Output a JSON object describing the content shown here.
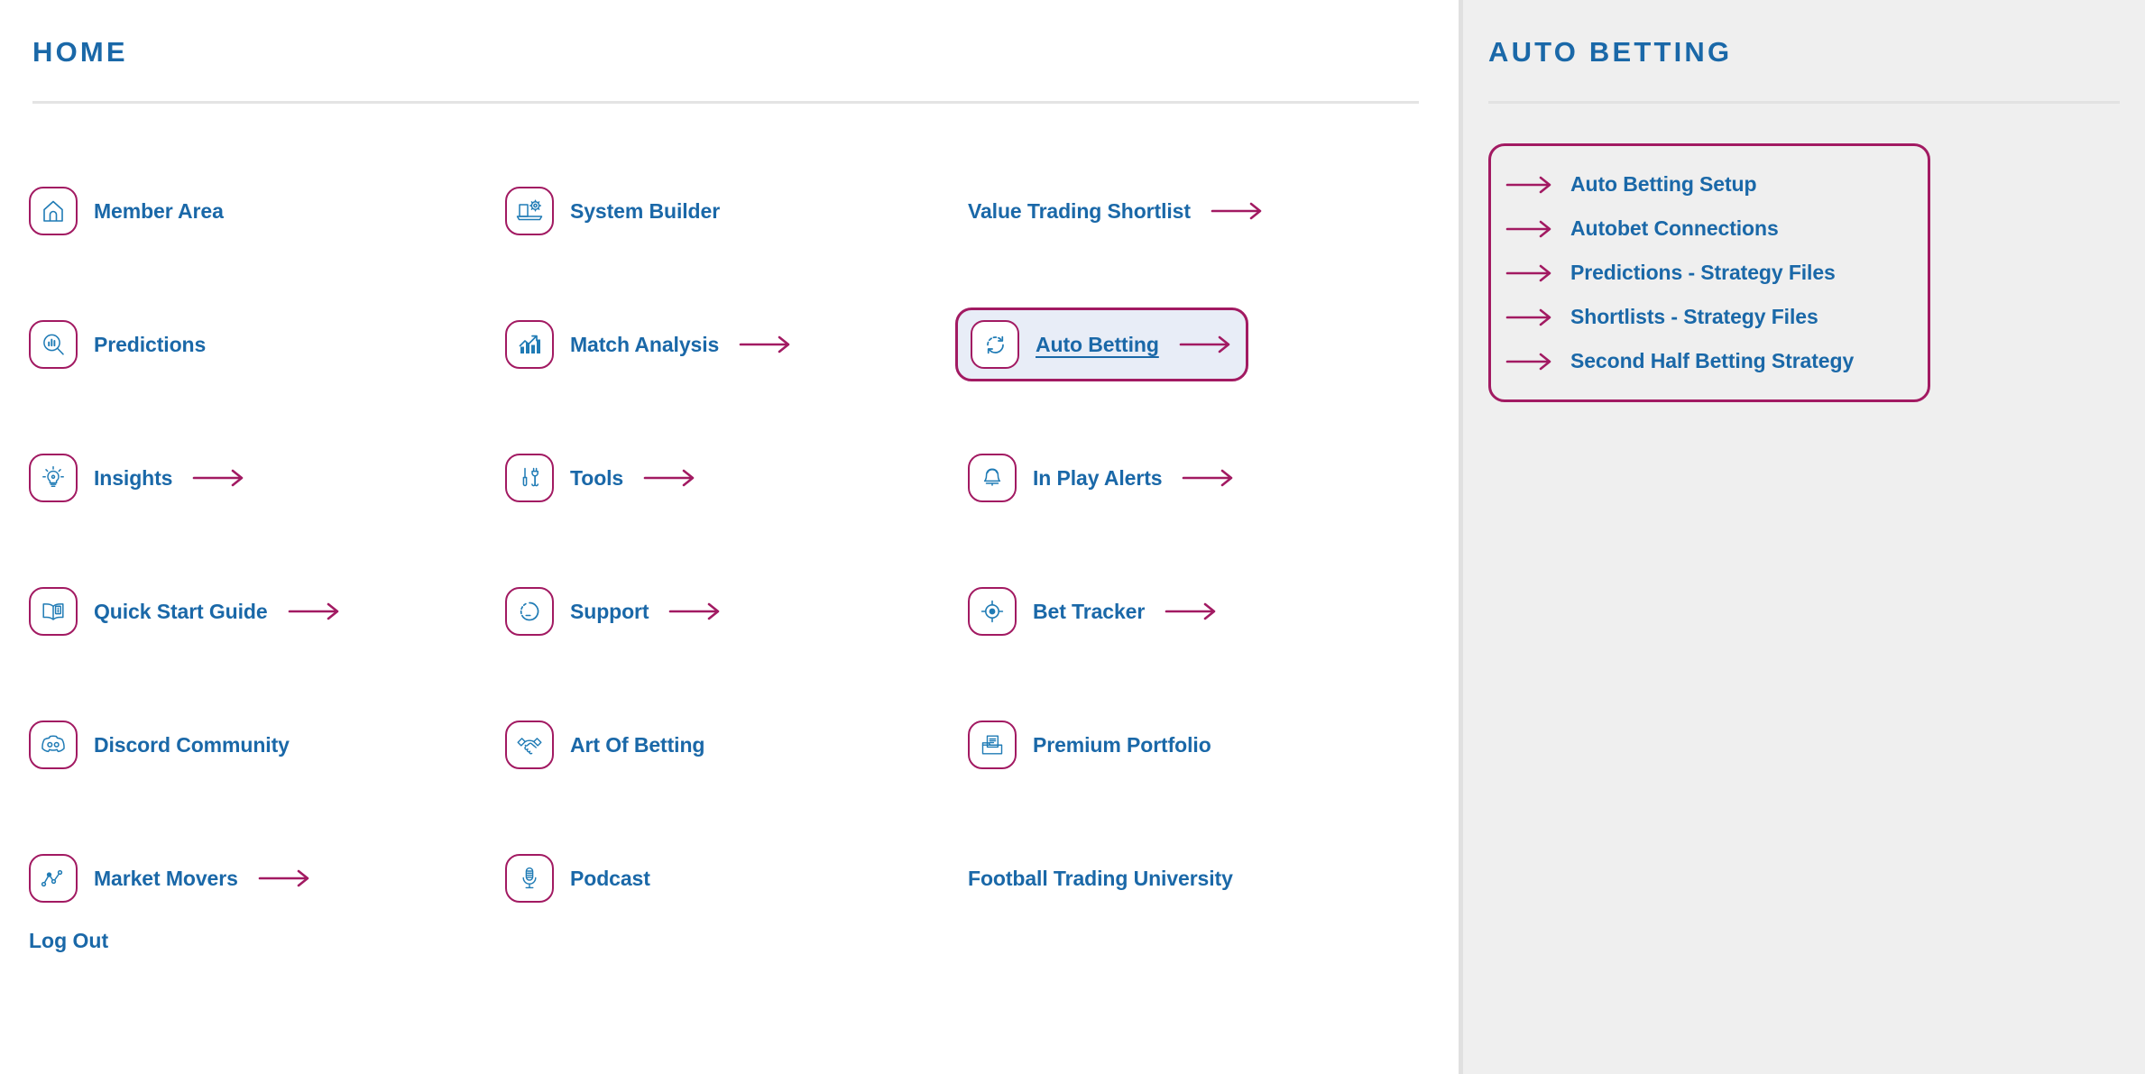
{
  "main": {
    "title": "HOME",
    "logout_label": "Log Out",
    "rows": [
      {
        "col1": {
          "label": "Member Area",
          "icon": "home-icon",
          "has_icon": true,
          "has_arrow": false,
          "selected": false
        },
        "col2": {
          "label": "System Builder",
          "icon": "laptop-gear-icon",
          "has_icon": true,
          "has_arrow": false,
          "selected": false
        },
        "col3": {
          "label": "Value Trading Shortlist",
          "icon": "",
          "has_icon": false,
          "has_arrow": true,
          "selected": false
        }
      },
      {
        "col1": {
          "label": "Predictions",
          "icon": "chart-magnifier-icon",
          "has_icon": true,
          "has_arrow": false,
          "selected": false
        },
        "col2": {
          "label": "Match Analysis",
          "icon": "bar-chart-up-icon",
          "has_icon": true,
          "has_arrow": true,
          "selected": false
        },
        "col3": {
          "label": "Auto Betting",
          "icon": "refresh-cycle-icon",
          "has_icon": true,
          "has_arrow": true,
          "selected": true
        }
      },
      {
        "col1": {
          "label": "Insights",
          "icon": "lightbulb-icon",
          "has_icon": true,
          "has_arrow": true,
          "selected": false
        },
        "col2": {
          "label": "Tools",
          "icon": "tools-icon",
          "has_icon": true,
          "has_arrow": true,
          "selected": false
        },
        "col3": {
          "label": "In Play Alerts",
          "icon": "bell-icon",
          "has_icon": true,
          "has_arrow": true,
          "selected": false
        }
      },
      {
        "col1": {
          "label": "Quick Start Guide",
          "icon": "open-book-info-icon",
          "has_icon": true,
          "has_arrow": true,
          "selected": false
        },
        "col2": {
          "label": "Support",
          "icon": "lifebuoy-icon",
          "has_icon": true,
          "has_arrow": true,
          "selected": false
        },
        "col3": {
          "label": "Bet Tracker",
          "icon": "target-icon",
          "has_icon": true,
          "has_arrow": true,
          "selected": false
        }
      },
      {
        "col1": {
          "label": "Discord Community",
          "icon": "discord-icon",
          "has_icon": true,
          "has_arrow": false,
          "selected": false
        },
        "col2": {
          "label": "Art Of Betting",
          "icon": "handshake-icon",
          "has_icon": true,
          "has_arrow": false,
          "selected": false
        },
        "col3": {
          "label": "Premium Portfolio",
          "icon": "folder-doc-icon",
          "has_icon": true,
          "has_arrow": false,
          "selected": false
        }
      },
      {
        "col1": {
          "label": "Market Movers",
          "icon": "line-chart-icon",
          "has_icon": true,
          "has_arrow": true,
          "selected": false
        },
        "col2": {
          "label": "Podcast",
          "icon": "microphone-icon",
          "has_icon": true,
          "has_arrow": false,
          "selected": false
        },
        "col3": {
          "label": "Football Trading University",
          "icon": "",
          "has_icon": false,
          "has_arrow": false,
          "selected": false
        }
      }
    ]
  },
  "sidebar": {
    "title": "AUTO BETTING",
    "items": [
      {
        "label": "Auto Betting Setup"
      },
      {
        "label": "Autobet Connections"
      },
      {
        "label": "Predictions - Strategy Files"
      },
      {
        "label": "Shortlists - Strategy Files"
      },
      {
        "label": "Second Half Betting Strategy"
      }
    ]
  },
  "colors": {
    "accent_magenta": "#a21a62",
    "link_blue": "#1a68a8",
    "icon_blue": "#1f7bb5",
    "sidebar_bg": "#efefef",
    "selected_bg": "#e8edf7",
    "divider": "#e4e4e4"
  }
}
